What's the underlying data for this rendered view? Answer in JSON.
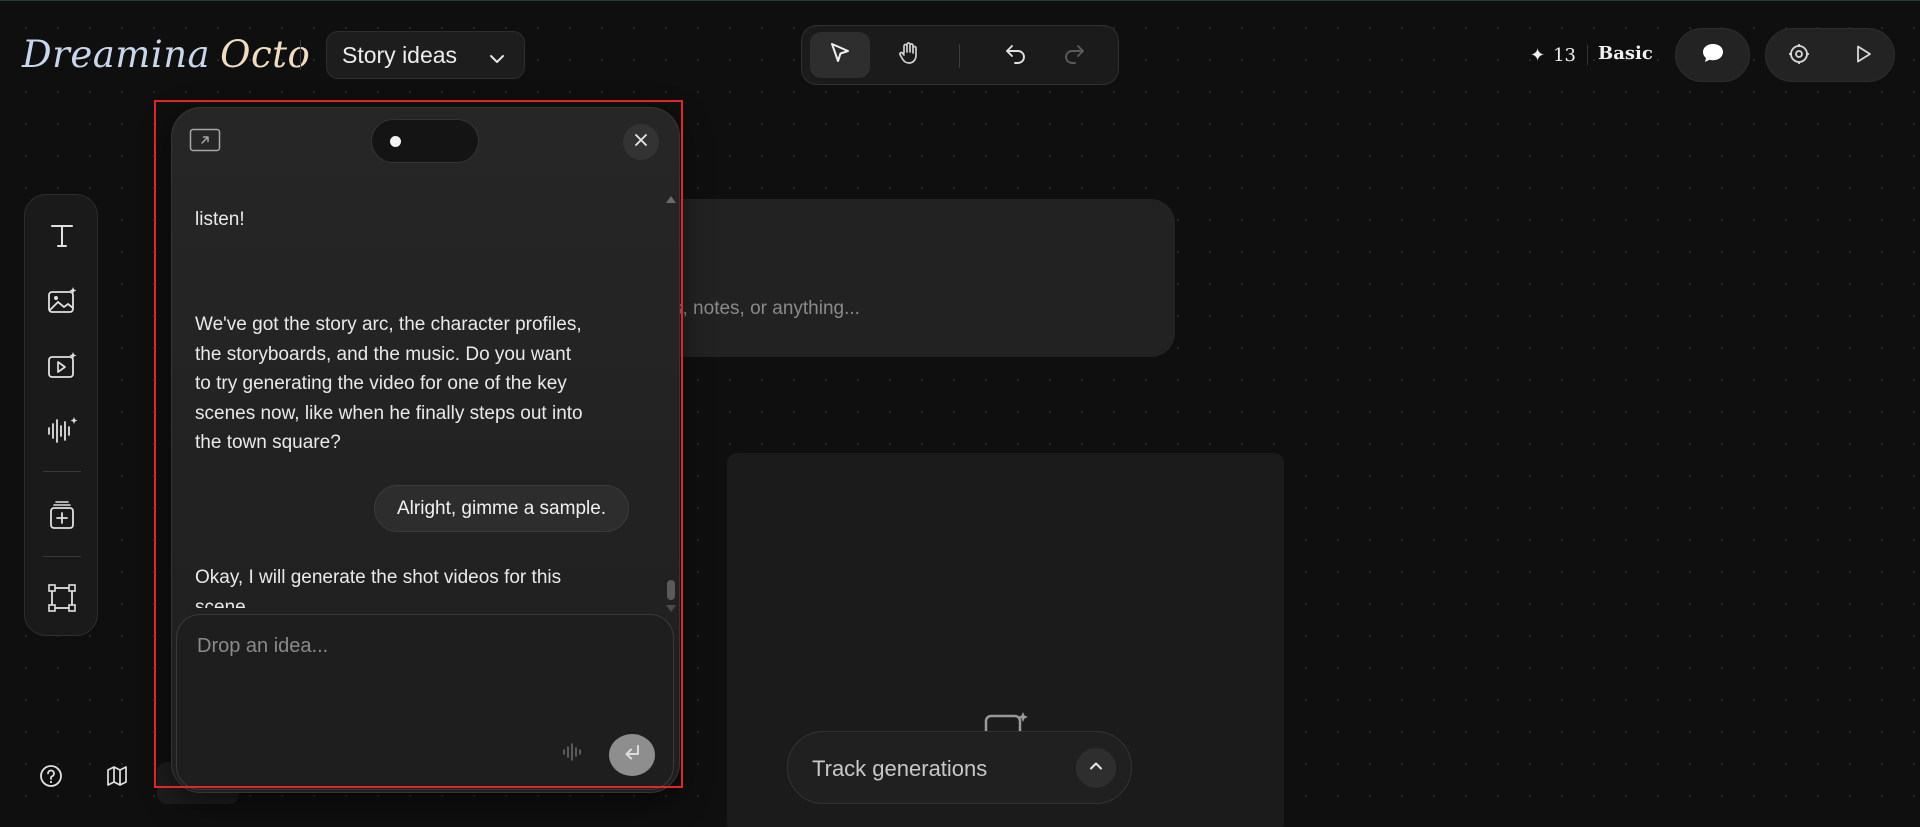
{
  "app": {
    "logo_part1": "Dreamina",
    "logo_part2": "Octo",
    "project_title": "Story ideas"
  },
  "header": {
    "credits_icon": "✦",
    "credits_count": "13",
    "plan": "Basic"
  },
  "canvas": {
    "card_text": "s, notes, or anything...",
    "track_label": "Track generations"
  },
  "chat": {
    "messages": {
      "partial_text": "listen!",
      "bot_lines_1": [
        "We've got the story arc, the character profiles,",
        "the storyboards, and the music. Do you want",
        "to try generating the video for one of the key",
        "scenes now, like when he finally steps out into",
        "the town square?"
      ],
      "user_text": "Alright, gimme a sample.",
      "bot_lines_2": [
        "Okay, I will generate the shot videos for this",
        "scene."
      ]
    },
    "input_placeholder": "Drop an idea..."
  },
  "colors": {
    "background": "#0f0f0f",
    "panel": "#262626",
    "highlight": "#e0262d",
    "send_button": "#8e8e8e"
  },
  "icons": {
    "header": [
      "chevron-down-icon",
      "select-cursor-icon",
      "hand-pan-icon",
      "undo-icon",
      "redo-icon",
      "chat-bubble-icon",
      "settings-icon",
      "play-icon"
    ],
    "left_toolbar": [
      "text-icon",
      "image-gen-icon",
      "video-gen-icon",
      "audio-gen-icon",
      "add-card-icon",
      "frame-icon"
    ],
    "bottom": [
      "help-icon",
      "map-icon",
      "chevron-up-icon"
    ],
    "panel": [
      "expand-icon",
      "close-icon",
      "voice-icon",
      "send-icon"
    ]
  }
}
